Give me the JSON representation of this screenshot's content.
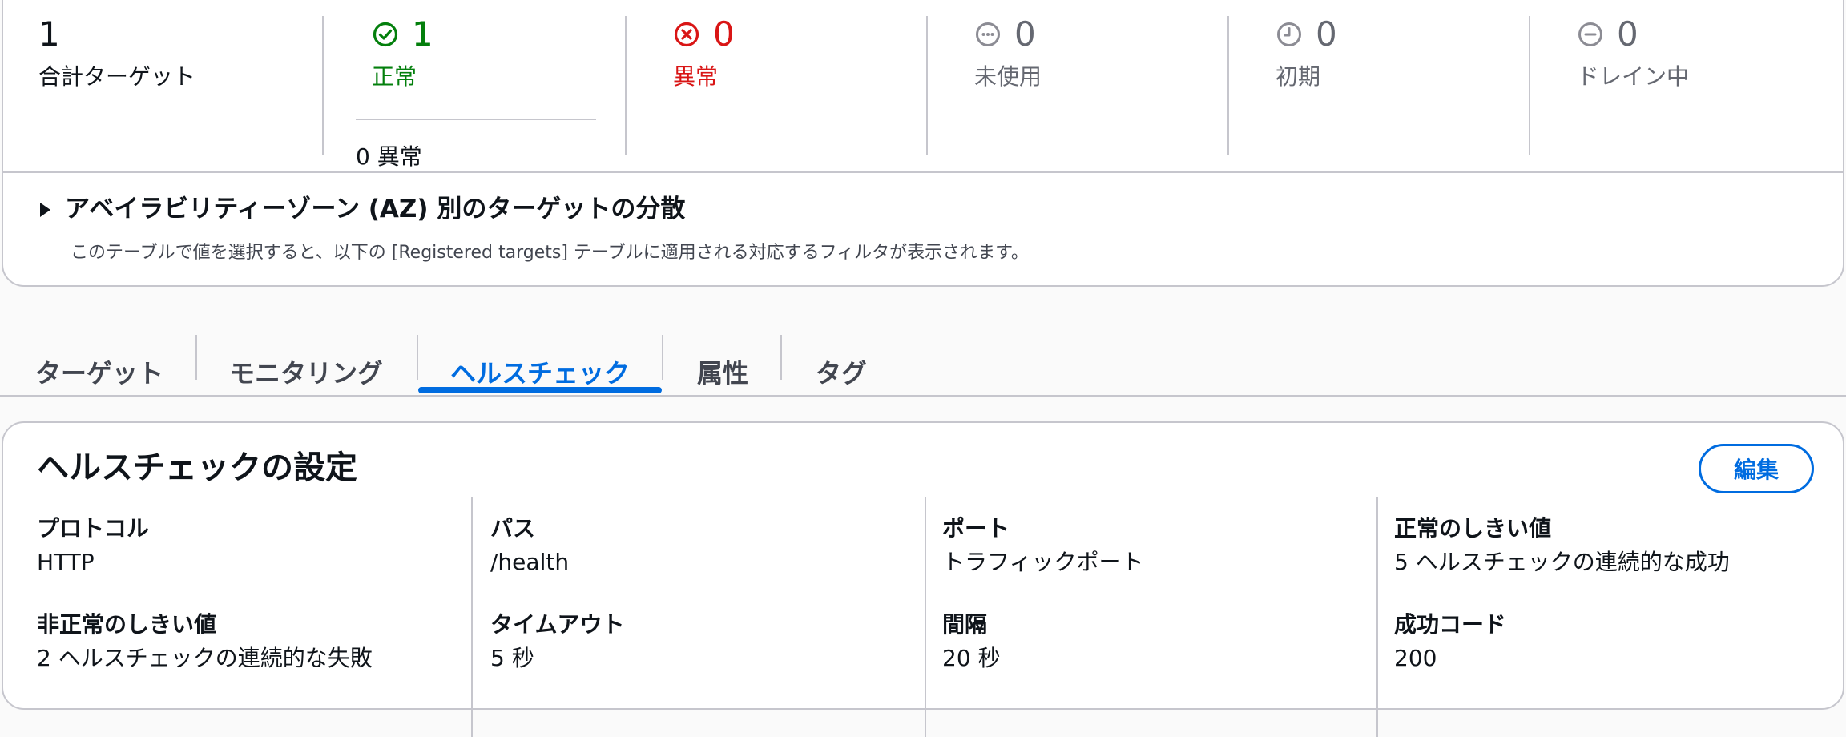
{
  "summary": {
    "total": {
      "value": "1",
      "label": "合計ターゲット"
    },
    "healthy": {
      "value": "1",
      "label": "正常",
      "sub": "0 異常",
      "icon": "check-circle-icon",
      "color": "#037f0c"
    },
    "unhealthy": {
      "value": "0",
      "label": "異常",
      "icon": "x-circle-icon",
      "color": "#d91515"
    },
    "unused": {
      "value": "0",
      "label": "未使用",
      "icon": "dots-circle-icon",
      "color": "#656871"
    },
    "initial": {
      "value": "0",
      "label": "初期",
      "icon": "clock-circle-icon",
      "color": "#656871"
    },
    "draining": {
      "value": "0",
      "label": "ドレイン中",
      "icon": "minus-circle-icon",
      "color": "#656871"
    }
  },
  "az": {
    "title": "アベイラビリティーゾーン (AZ) 別のターゲットの分散",
    "description": "このテーブルで値を選択すると、以下の [Registered targets] テーブルに適用される対応するフィルタが表示されます。"
  },
  "tabs": [
    {
      "label": "ターゲット"
    },
    {
      "label": "モニタリング"
    },
    {
      "label": "ヘルスチェック",
      "active": true
    },
    {
      "label": "属性"
    },
    {
      "label": "タグ"
    }
  ],
  "health_check": {
    "title": "ヘルスチェックの設定",
    "edit_label": "編集",
    "fields": [
      {
        "key": "プロトコル",
        "value": "HTTP"
      },
      {
        "key": "パス",
        "value": "/health"
      },
      {
        "key": "ポート",
        "value": "トラフィックポート"
      },
      {
        "key": "正常のしきい値",
        "value": "5 ヘルスチェックの連続的な成功"
      },
      {
        "key": "非正常のしきい値",
        "value": "2 ヘルスチェックの連続的な失敗"
      },
      {
        "key": "タイムアウト",
        "value": "5 秒"
      },
      {
        "key": "間隔",
        "value": "20 秒"
      },
      {
        "key": "成功コード",
        "value": "200"
      }
    ]
  }
}
